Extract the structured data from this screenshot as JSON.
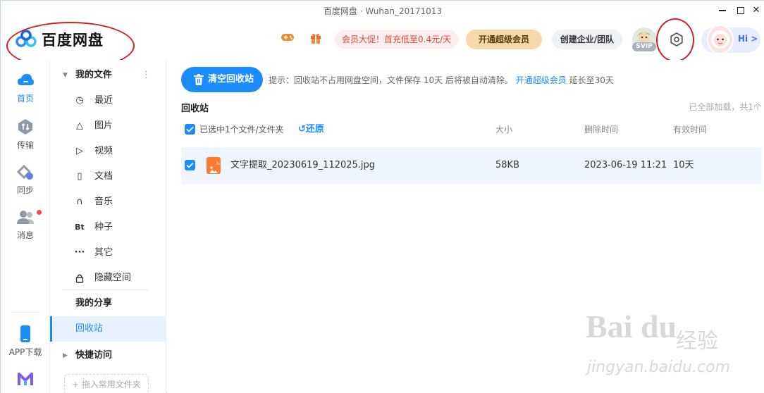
{
  "window": {
    "title": "百度网盘  ·  Wuhan_20171013"
  },
  "header": {
    "logo_text": "百度网盘",
    "promo_text": "会员大促！首充低至0.4元/天",
    "svip_button": "开通超级会员",
    "team_button": "创建企业/团队",
    "svip_tag": "SVIP",
    "hi_text": "Hi",
    "chevron": ">"
  },
  "rail": {
    "items": [
      {
        "label": "首页",
        "icon": "cloud-icon"
      },
      {
        "label": "传输",
        "icon": "transfer-icon"
      },
      {
        "label": "同步",
        "icon": "sync-icon"
      },
      {
        "label": "消息",
        "icon": "message-icon"
      }
    ],
    "app_download": "APP下载"
  },
  "nav": {
    "my_files": "我的文件",
    "items": [
      {
        "label": "最近",
        "icon": "clock-icon"
      },
      {
        "label": "图片",
        "icon": "image-icon"
      },
      {
        "label": "视频",
        "icon": "video-icon"
      },
      {
        "label": "文档",
        "icon": "document-icon"
      },
      {
        "label": "音乐",
        "icon": "headphones-icon"
      },
      {
        "label": "种子",
        "icon": "bt-icon"
      },
      {
        "label": "其它",
        "icon": "more-icon"
      },
      {
        "label": "隐藏空间",
        "icon": "lock-icon"
      }
    ],
    "my_share": "我的分享",
    "recycle": "回收站",
    "quick_access": "快捷访问",
    "drop_hint": "+ 拖入常用文件夹"
  },
  "main": {
    "clear_button": "清空回收站",
    "hint_text": "提示：回收站不占用网盘空间，文件保存 10天 后将被自动清除。",
    "hint_link": "开通超级会员",
    "hint_suffix": " 延长至30天",
    "section_title": "回收站",
    "loaded_status": "已全部加载，共1个",
    "selected_text": "已选中1个文件/文件夹",
    "restore": "还原",
    "columns": {
      "size": "大小",
      "deleted_time": "删除时间",
      "valid_time": "有效时间"
    },
    "rows": [
      {
        "name": "文字提取_20230619_112025.jpg",
        "size": "58KB",
        "deleted_time": "2023-06-19 11:21",
        "valid_time": "10天"
      }
    ]
  },
  "watermark": {
    "logo": "Bai du",
    "cn": "经验",
    "url": "jingyan.baidu.com"
  },
  "colors": {
    "accent": "#1a8cff",
    "annotation": "#d42020",
    "promo": "#e4453a",
    "svip_bg": "#f8d7a9"
  }
}
